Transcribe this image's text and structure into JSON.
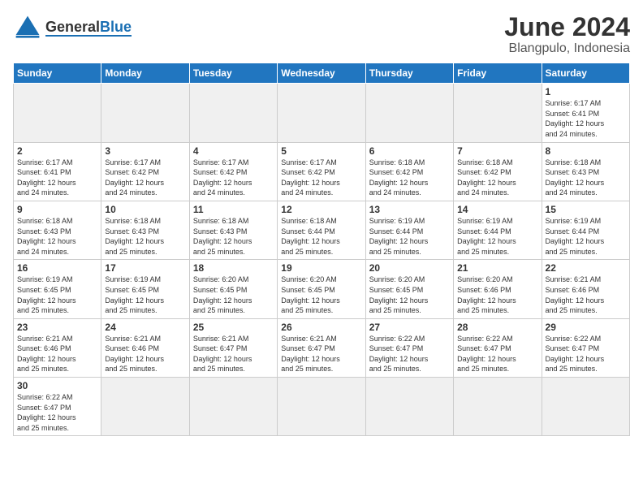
{
  "header": {
    "title": "June 2024",
    "subtitle": "Blangpulo, Indonesia",
    "logo_general": "General",
    "logo_blue": "Blue"
  },
  "weekdays": [
    "Sunday",
    "Monday",
    "Tuesday",
    "Wednesday",
    "Thursday",
    "Friday",
    "Saturday"
  ],
  "weeks": [
    [
      {
        "day": "",
        "info": "",
        "empty": true
      },
      {
        "day": "",
        "info": "",
        "empty": true
      },
      {
        "day": "",
        "info": "",
        "empty": true
      },
      {
        "day": "",
        "info": "",
        "empty": true
      },
      {
        "day": "",
        "info": "",
        "empty": true
      },
      {
        "day": "",
        "info": "",
        "empty": true
      },
      {
        "day": "1",
        "info": "Sunrise: 6:17 AM\nSunset: 6:41 PM\nDaylight: 12 hours\nand 24 minutes."
      }
    ],
    [
      {
        "day": "2",
        "info": "Sunrise: 6:17 AM\nSunset: 6:41 PM\nDaylight: 12 hours\nand 24 minutes."
      },
      {
        "day": "3",
        "info": "Sunrise: 6:17 AM\nSunset: 6:42 PM\nDaylight: 12 hours\nand 24 minutes."
      },
      {
        "day": "4",
        "info": "Sunrise: 6:17 AM\nSunset: 6:42 PM\nDaylight: 12 hours\nand 24 minutes."
      },
      {
        "day": "5",
        "info": "Sunrise: 6:17 AM\nSunset: 6:42 PM\nDaylight: 12 hours\nand 24 minutes."
      },
      {
        "day": "6",
        "info": "Sunrise: 6:18 AM\nSunset: 6:42 PM\nDaylight: 12 hours\nand 24 minutes."
      },
      {
        "day": "7",
        "info": "Sunrise: 6:18 AM\nSunset: 6:42 PM\nDaylight: 12 hours\nand 24 minutes."
      },
      {
        "day": "8",
        "info": "Sunrise: 6:18 AM\nSunset: 6:43 PM\nDaylight: 12 hours\nand 24 minutes."
      }
    ],
    [
      {
        "day": "9",
        "info": "Sunrise: 6:18 AM\nSunset: 6:43 PM\nDaylight: 12 hours\nand 24 minutes."
      },
      {
        "day": "10",
        "info": "Sunrise: 6:18 AM\nSunset: 6:43 PM\nDaylight: 12 hours\nand 25 minutes."
      },
      {
        "day": "11",
        "info": "Sunrise: 6:18 AM\nSunset: 6:43 PM\nDaylight: 12 hours\nand 25 minutes."
      },
      {
        "day": "12",
        "info": "Sunrise: 6:18 AM\nSunset: 6:44 PM\nDaylight: 12 hours\nand 25 minutes."
      },
      {
        "day": "13",
        "info": "Sunrise: 6:19 AM\nSunset: 6:44 PM\nDaylight: 12 hours\nand 25 minutes."
      },
      {
        "day": "14",
        "info": "Sunrise: 6:19 AM\nSunset: 6:44 PM\nDaylight: 12 hours\nand 25 minutes."
      },
      {
        "day": "15",
        "info": "Sunrise: 6:19 AM\nSunset: 6:44 PM\nDaylight: 12 hours\nand 25 minutes."
      }
    ],
    [
      {
        "day": "16",
        "info": "Sunrise: 6:19 AM\nSunset: 6:45 PM\nDaylight: 12 hours\nand 25 minutes."
      },
      {
        "day": "17",
        "info": "Sunrise: 6:19 AM\nSunset: 6:45 PM\nDaylight: 12 hours\nand 25 minutes."
      },
      {
        "day": "18",
        "info": "Sunrise: 6:20 AM\nSunset: 6:45 PM\nDaylight: 12 hours\nand 25 minutes."
      },
      {
        "day": "19",
        "info": "Sunrise: 6:20 AM\nSunset: 6:45 PM\nDaylight: 12 hours\nand 25 minutes."
      },
      {
        "day": "20",
        "info": "Sunrise: 6:20 AM\nSunset: 6:45 PM\nDaylight: 12 hours\nand 25 minutes."
      },
      {
        "day": "21",
        "info": "Sunrise: 6:20 AM\nSunset: 6:46 PM\nDaylight: 12 hours\nand 25 minutes."
      },
      {
        "day": "22",
        "info": "Sunrise: 6:21 AM\nSunset: 6:46 PM\nDaylight: 12 hours\nand 25 minutes."
      }
    ],
    [
      {
        "day": "23",
        "info": "Sunrise: 6:21 AM\nSunset: 6:46 PM\nDaylight: 12 hours\nand 25 minutes."
      },
      {
        "day": "24",
        "info": "Sunrise: 6:21 AM\nSunset: 6:46 PM\nDaylight: 12 hours\nand 25 minutes."
      },
      {
        "day": "25",
        "info": "Sunrise: 6:21 AM\nSunset: 6:47 PM\nDaylight: 12 hours\nand 25 minutes."
      },
      {
        "day": "26",
        "info": "Sunrise: 6:21 AM\nSunset: 6:47 PM\nDaylight: 12 hours\nand 25 minutes."
      },
      {
        "day": "27",
        "info": "Sunrise: 6:22 AM\nSunset: 6:47 PM\nDaylight: 12 hours\nand 25 minutes."
      },
      {
        "day": "28",
        "info": "Sunrise: 6:22 AM\nSunset: 6:47 PM\nDaylight: 12 hours\nand 25 minutes."
      },
      {
        "day": "29",
        "info": "Sunrise: 6:22 AM\nSunset: 6:47 PM\nDaylight: 12 hours\nand 25 minutes."
      }
    ],
    [
      {
        "day": "30",
        "info": "Sunrise: 6:22 AM\nSunset: 6:47 PM\nDaylight: 12 hours\nand 25 minutes."
      },
      {
        "day": "",
        "info": "",
        "empty": true
      },
      {
        "day": "",
        "info": "",
        "empty": true
      },
      {
        "day": "",
        "info": "",
        "empty": true
      },
      {
        "day": "",
        "info": "",
        "empty": true
      },
      {
        "day": "",
        "info": "",
        "empty": true
      },
      {
        "day": "",
        "info": "",
        "empty": true
      }
    ]
  ]
}
